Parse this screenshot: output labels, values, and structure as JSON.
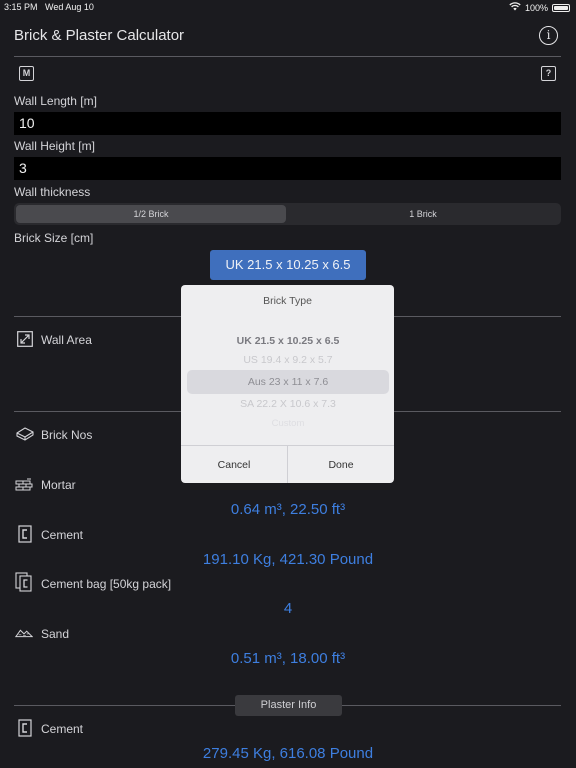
{
  "status": {
    "time": "3:15 PM",
    "date": "Wed Aug 10",
    "battery": "100%"
  },
  "app": {
    "title": "Brick & Plaster Calculator",
    "info_icon": "info-icon",
    "m_icon_label": "M",
    "help_icon_label": "?"
  },
  "inputs": {
    "length_label": "Wall Length [m]",
    "length_value": "10",
    "height_label": "Wall Height [m]",
    "height_value": "3",
    "thickness_label": "Wall thickness",
    "thickness_options": [
      "1/2 Brick",
      "1 Brick"
    ],
    "thickness_selected": "1/2 Brick",
    "size_label": "Brick Size [cm]",
    "size_button": "UK 21.5 x 10.25 x 6.5"
  },
  "results": {
    "wall_area_label": "Wall Area",
    "brick_nos_label": "Brick Nos",
    "mortar_label": "Mortar",
    "mortar_value": "0.64 m³, 22.50 ft³",
    "cement_label": "Cement",
    "cement_value": "191.10 Kg, 421.30 Pound",
    "cement_bag_label": "Cement bag [50kg pack]",
    "cement_bag_value": "4",
    "sand_label": "Sand",
    "sand_value": "0.51 m³, 18.00 ft³"
  },
  "plaster": {
    "section_label": "Plaster Info",
    "cement_label": "Cement",
    "cement_value": "279.45 Kg, 616.08 Pound"
  },
  "modal": {
    "title": "Brick Type",
    "options": [
      "UK 21.5 x 10.25 x 6.5",
      "US 19.4 x 9.2 x 5.7",
      "Aus 23 x 11 x 7.6",
      "SA 22.2 X 10.6 x 7.3",
      "Custom"
    ],
    "selected": "Aus 23 x 11 x 7.6",
    "cancel": "Cancel",
    "done": "Done"
  },
  "colors": {
    "accent": "#3e7fe0",
    "button": "#3f6fbd",
    "background": "#1b1b1f"
  }
}
